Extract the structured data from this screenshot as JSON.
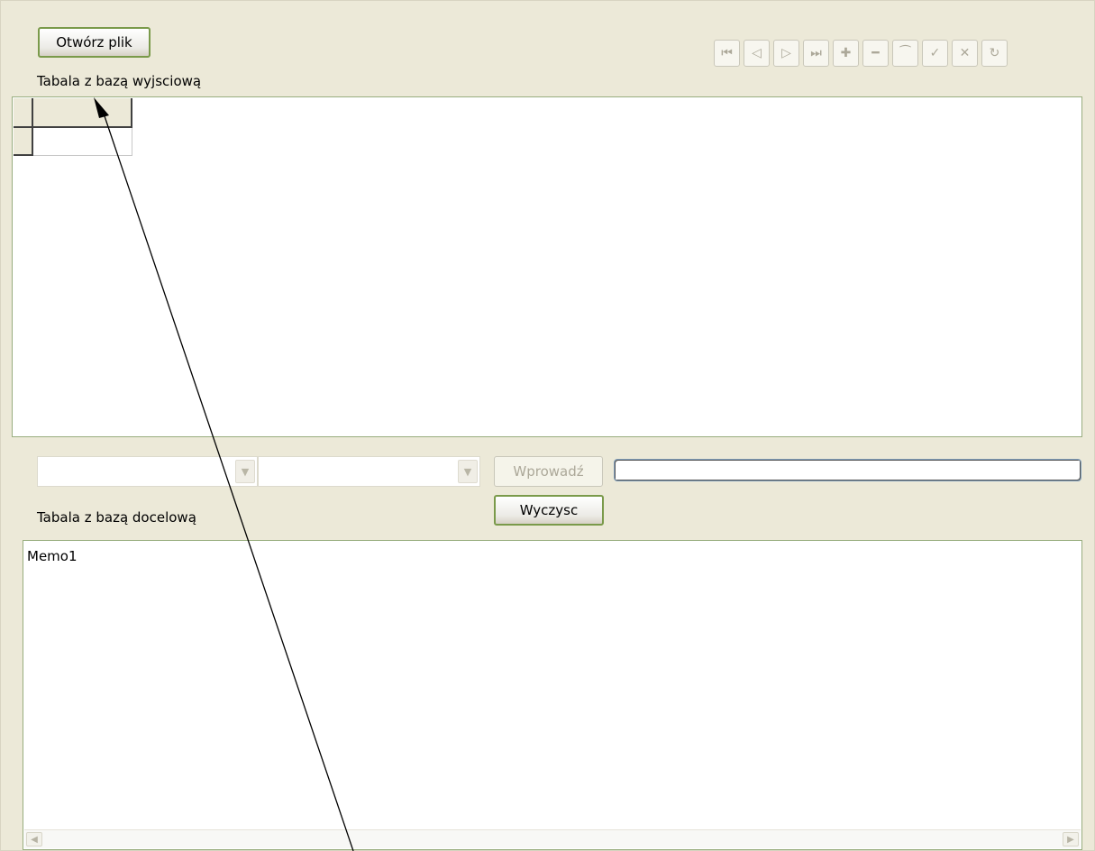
{
  "toolbar": {
    "open_file_label": "Otwórz plik",
    "nav_icons": [
      "first-record-icon",
      "prior-record-icon",
      "next-record-icon",
      "last-record-icon",
      "insert-record-icon",
      "delete-record-icon",
      "edit-record-icon",
      "post-edit-icon",
      "cancel-edit-icon",
      "refresh-data-icon"
    ],
    "nav_glyphs": [
      "⏮",
      "◁",
      "▷",
      "⏭",
      "✚",
      "━",
      "⁀",
      "✓",
      "✕",
      "↻"
    ]
  },
  "source_table": {
    "label": "Tabala z bazą wyjsciową"
  },
  "controls": {
    "combo1_value": "",
    "combo2_value": "",
    "enter_label": "Wprowadź",
    "clear_label": "Wyczysc",
    "edit_value": ""
  },
  "target_table": {
    "label": "Tabala z bazą docelową",
    "memo_text": "Memo1"
  },
  "colors": {
    "form_bg": "#ece9d8",
    "button_border": "#7a9a4a",
    "panel_border": "#98ad7e"
  }
}
